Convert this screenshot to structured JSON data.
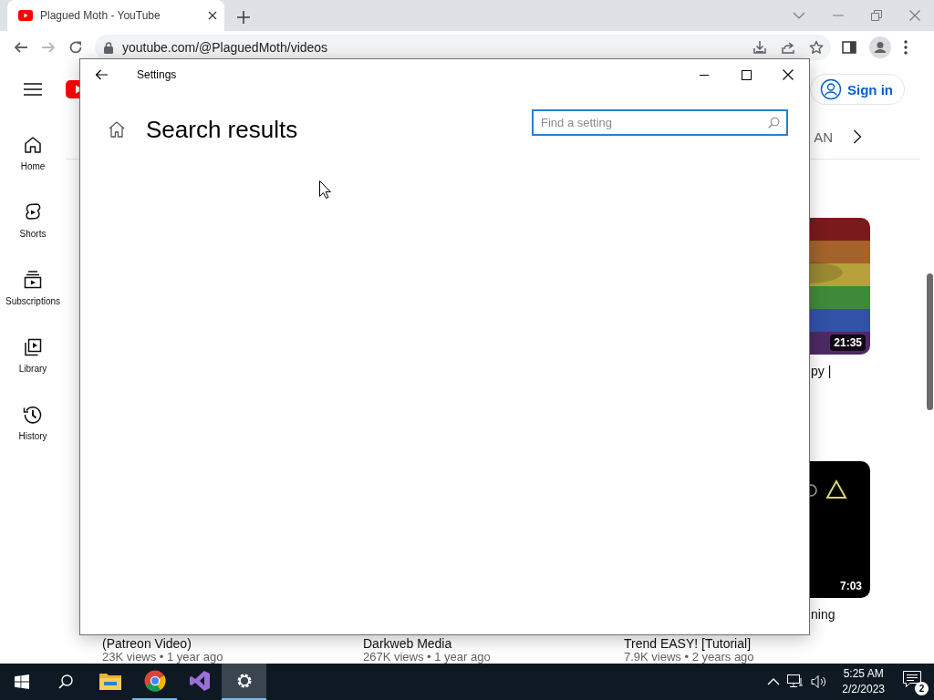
{
  "browser": {
    "tabs": [
      {
        "title": "Plagued Moth - YouTube",
        "selected": true
      }
    ],
    "nav": [
      {
        "disabled": false
      },
      {
        "disabled": true
      },
      {
        "disabled": false
      }
    ],
    "address": "youtube.com/@PlaguedMoth/videos"
  },
  "youtube": {
    "sidebar": [
      {
        "label": "Home"
      },
      {
        "label": "Shorts"
      },
      {
        "label": "Subscriptions"
      },
      {
        "label": "Library"
      },
      {
        "label": "History"
      }
    ],
    "sign_in": "Sign in",
    "chip": "AN",
    "video_rows": [
      [
        {
          "duration": "21:35",
          "title_lines": [
            "py |"
          ]
        }
      ],
      [
        {
          "title_lines": [
            "(Patreon Video)"
          ],
          "meta": "23K views • 1 year ago"
        },
        {
          "title_lines": [
            "Darkweb Media"
          ],
          "meta": "267K views • 1 year ago"
        },
        {
          "duration": "7:03",
          "title_lines": [
            "ning",
            "Trend EASY! [Tutorial]"
          ],
          "meta": "7.9K views • 2 years ago"
        }
      ]
    ]
  },
  "settings": {
    "title": "Settings",
    "heading": "Search results",
    "search": {
      "placeholder": "Find a setting"
    }
  },
  "taskbar": {
    "apps": [
      {
        "selected": false,
        "running": false
      },
      {
        "selected": false,
        "running": true
      },
      {
        "selected": false,
        "running": false
      },
      {
        "selected": true,
        "running": true
      }
    ],
    "time": "5:25 AM",
    "date": "2/2/2023",
    "notifications": "2"
  }
}
